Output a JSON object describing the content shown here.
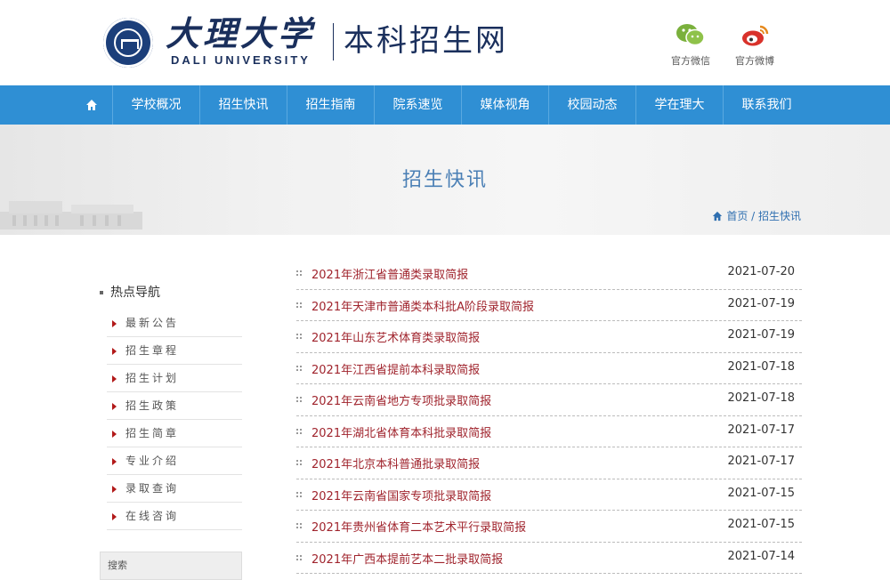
{
  "header": {
    "logo_cn": "大理大学",
    "logo_en": "DALI UNIVERSITY",
    "site_name": "本科招生网",
    "social": [
      {
        "label": "官方微信",
        "icon": "wechat-icon",
        "color": "#7ab03c"
      },
      {
        "label": "官方微博",
        "icon": "weibo-icon",
        "color": "#d9322b"
      }
    ]
  },
  "nav": {
    "home_icon": "home-icon",
    "items": [
      "学校概况",
      "招生快讯",
      "招生指南",
      "院系速览",
      "媒体视角",
      "校园动态",
      "学在理大",
      "联系我们"
    ],
    "color": "#2f8fd4"
  },
  "banner": {
    "title": "招生快讯",
    "breadcrumb": "首页 / 招生快讯"
  },
  "sidebar": {
    "title": "热点导航",
    "items": [
      "最新公告",
      "招生章程",
      "招生计划",
      "招生政策",
      "招生简章",
      "专业介绍",
      "录取查询",
      "在线咨询"
    ],
    "search_label": "搜索"
  },
  "news": [
    {
      "title": "2021年浙江省普通类录取简报",
      "date": "2021-07-20"
    },
    {
      "title": "2021年天津市普通类本科批A阶段录取简报",
      "date": "2021-07-19"
    },
    {
      "title": "2021年山东艺术体育类录取简报",
      "date": "2021-07-19"
    },
    {
      "title": "2021年江西省提前本科录取简报",
      "date": "2021-07-18"
    },
    {
      "title": "2021年云南省地方专项批录取简报",
      "date": "2021-07-18"
    },
    {
      "title": "2021年湖北省体育本科批录取简报",
      "date": "2021-07-17"
    },
    {
      "title": "2021年北京本科普通批录取简报",
      "date": "2021-07-17"
    },
    {
      "title": "2021年云南省国家专项批录取简报",
      "date": "2021-07-15"
    },
    {
      "title": "2021年贵州省体育二本艺术平行录取简报",
      "date": "2021-07-15"
    },
    {
      "title": "2021年广西本提前艺本二批录取简报",
      "date": "2021-07-14"
    }
  ]
}
